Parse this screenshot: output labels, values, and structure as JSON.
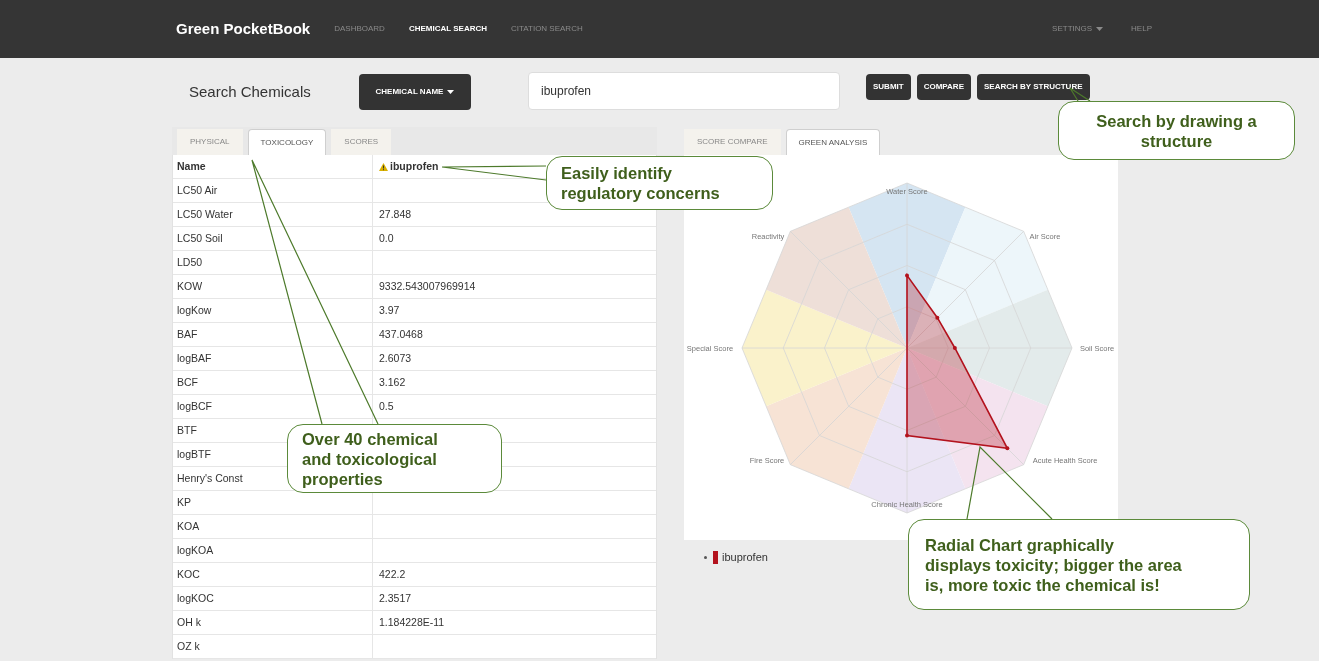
{
  "header": {
    "brand": "Green PocketBook",
    "nav": [
      {
        "label": "DASHBOARD",
        "selected": false
      },
      {
        "label": "CHEMICAL SEARCH",
        "selected": true
      },
      {
        "label": "CITATION SEARCH",
        "selected": false
      }
    ],
    "right_nav": [
      {
        "label": "SETTINGS",
        "dropdown": true
      },
      {
        "label": "HELP",
        "dropdown": false
      }
    ]
  },
  "search": {
    "title": "Search Chemicals",
    "type_button": "CHEMICAL NAME",
    "value": "ibuprofen",
    "buttons": [
      "SUBMIT",
      "COMPARE",
      "SEARCH BY STRUCTURE"
    ]
  },
  "left_panel": {
    "tabs": [
      {
        "label": "PHYSICAL",
        "selected": false
      },
      {
        "label": "TOXICOLOGY",
        "selected": true
      },
      {
        "label": "SCORES",
        "selected": false
      }
    ],
    "table": {
      "header": {
        "name": "Name",
        "value": "ibuprofen",
        "warning": true
      },
      "rows": [
        {
          "property": "LC50 Air"
        },
        {
          "property": "LC50 Water",
          "value": "27.848"
        },
        {
          "property": "LC50 Soil",
          "value": "0.0"
        },
        {
          "property": "LD50"
        },
        {
          "property": "KOW",
          "value": "9332.543007969914"
        },
        {
          "property": "logKow",
          "value": "3.97"
        },
        {
          "property": "BAF",
          "value": "437.0468"
        },
        {
          "property": "logBAF",
          "value": "2.6073"
        },
        {
          "property": "BCF",
          "value": "3.162"
        },
        {
          "property": "logBCF",
          "value": "0.5"
        },
        {
          "property": "BTF"
        },
        {
          "property": "logBTF"
        },
        {
          "property": "Henry's Const"
        },
        {
          "property": "KP"
        },
        {
          "property": "KOA"
        },
        {
          "property": "logKOA"
        },
        {
          "property": "KOC",
          "value": "422.2"
        },
        {
          "property": "logKOC",
          "value": "2.3517"
        },
        {
          "property": "OH k",
          "value": "1.184228E-11"
        },
        {
          "property": "OZ k"
        }
      ]
    }
  },
  "right_panel": {
    "tabs": [
      {
        "label": "SCORE COMPARE",
        "selected": false
      },
      {
        "label": "GREEN ANALYSIS",
        "selected": true
      }
    ],
    "chart": {
      "axes": [
        {
          "label": "Water Score",
          "color": "#d5e5f2"
        },
        {
          "label": "Air Score",
          "color": "#edf6fa"
        },
        {
          "label": "Soil Score",
          "color": "#e3ebeb"
        },
        {
          "label": "Acute Health Score",
          "color": "#f4e3ef"
        },
        {
          "label": "Chronic Health Score",
          "color": "#ebe5f5"
        },
        {
          "label": "Fire Score",
          "color": "#f7e3d5"
        },
        {
          "label": "Special Score",
          "color": "#faf2cb"
        },
        {
          "label": "Reactivity",
          "color": "#eedfd8"
        }
      ],
      "legend": [
        {
          "label": "ibuprofen",
          "color": "#b3121d"
        }
      ]
    }
  },
  "annotations": [
    {
      "lines": [
        "Search by drawing a",
        "structure"
      ]
    },
    {
      "lines": [
        "Easily identify",
        "regulatory concerns"
      ]
    },
    {
      "lines": [
        "Over 40 chemical",
        "and toxicological",
        "properties"
      ]
    },
    {
      "lines": [
        "Radial Chart graphically",
        "displays toxicity; bigger the area",
        "is, more toxic the chemical is!"
      ]
    }
  ]
}
